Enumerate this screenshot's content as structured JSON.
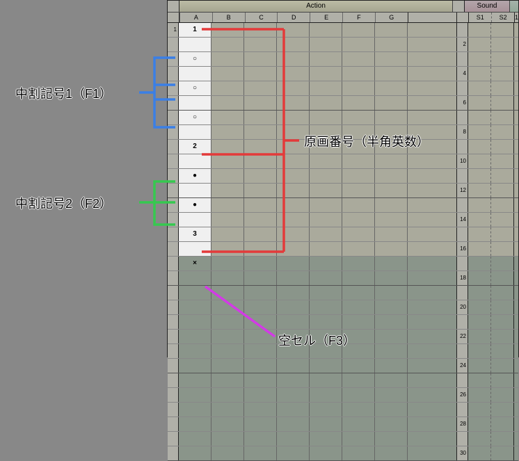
{
  "header": {
    "action": "Action",
    "sound": "Sound",
    "rest": ""
  },
  "action_cols": [
    "A",
    "B",
    "C",
    "D",
    "E",
    "F",
    "G"
  ],
  "sound_cols": [
    "S1",
    "S2"
  ],
  "rest_cols": [
    "1"
  ],
  "rows": [
    {
      "n": "1",
      "mark": "1",
      "right": ""
    },
    {
      "n": "",
      "mark": "",
      "right": "2"
    },
    {
      "n": "",
      "mark": "○",
      "right": ""
    },
    {
      "n": "",
      "mark": "",
      "right": "4"
    },
    {
      "n": "",
      "mark": "○",
      "right": ""
    },
    {
      "n": "",
      "mark": "",
      "right": "6"
    },
    {
      "n": "",
      "mark": "○",
      "right": ""
    },
    {
      "n": "",
      "mark": "",
      "right": "8"
    },
    {
      "n": "",
      "mark": "2",
      "right": ""
    },
    {
      "n": "",
      "mark": "",
      "right": "10"
    },
    {
      "n": "",
      "mark": "●",
      "right": ""
    },
    {
      "n": "",
      "mark": "",
      "right": "12"
    },
    {
      "n": "",
      "mark": "●",
      "right": ""
    },
    {
      "n": "",
      "mark": "",
      "right": "14"
    },
    {
      "n": "",
      "mark": "3",
      "right": ""
    },
    {
      "n": "",
      "mark": "",
      "right": "16"
    },
    {
      "n": "",
      "mark": "×",
      "right": ""
    },
    {
      "n": "",
      "mark": "",
      "right": "18"
    },
    {
      "n": "",
      "mark": "",
      "right": ""
    },
    {
      "n": "",
      "mark": "",
      "right": "20"
    },
    {
      "n": "",
      "mark": "",
      "right": ""
    },
    {
      "n": "",
      "mark": "",
      "right": "22"
    },
    {
      "n": "",
      "mark": "",
      "right": ""
    },
    {
      "n": "",
      "mark": "",
      "right": "24"
    },
    {
      "n": "",
      "mark": "",
      "right": ""
    },
    {
      "n": "",
      "mark": "",
      "right": "26"
    },
    {
      "n": "",
      "mark": "",
      "right": ""
    },
    {
      "n": "",
      "mark": "",
      "right": "28"
    },
    {
      "n": "",
      "mark": "",
      "right": ""
    },
    {
      "n": "",
      "mark": "",
      "right": "30"
    }
  ],
  "labels": {
    "inbetween1": "中割記号1（F1）",
    "inbetween2": "中割記号2（F2）",
    "genga": "原画番号（半角英数）",
    "empty": "空セル（F3）"
  }
}
